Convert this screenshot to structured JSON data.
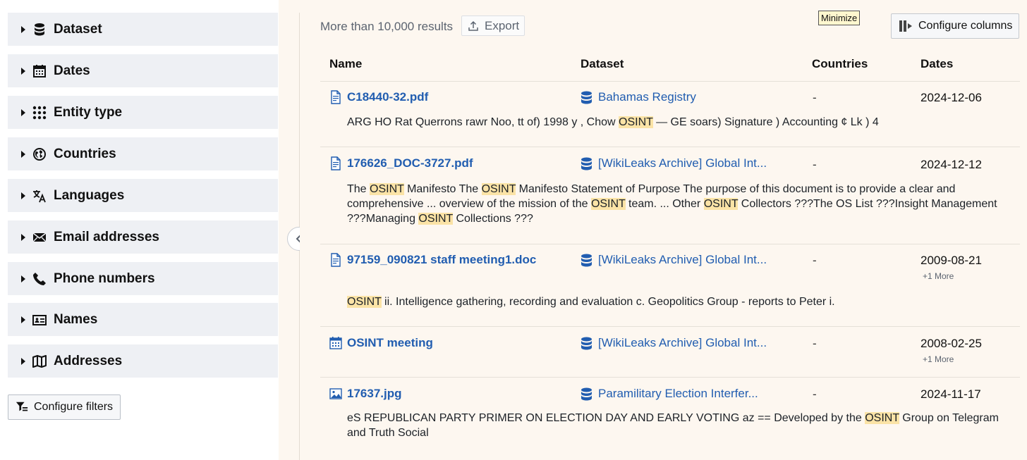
{
  "sidebar": {
    "facets": [
      {
        "label": "Dataset",
        "icon": "database-icon"
      },
      {
        "label": "Dates",
        "icon": "calendar-icon"
      },
      {
        "label": "Entity type",
        "icon": "grid-dots-icon"
      },
      {
        "label": "Countries",
        "icon": "globe-icon"
      },
      {
        "label": "Languages",
        "icon": "translate-icon"
      },
      {
        "label": "Email addresses",
        "icon": "envelope-icon"
      },
      {
        "label": "Phone numbers",
        "icon": "phone-icon"
      },
      {
        "label": "Names",
        "icon": "id-card-icon"
      },
      {
        "label": "Addresses",
        "icon": "map-icon"
      }
    ],
    "configure_filters_label": "Configure filters"
  },
  "toolbar": {
    "results_count": "More than 10,000 results",
    "export_label": "Export",
    "tooltip": "Minimize",
    "configure_columns_label": "Configure columns"
  },
  "table": {
    "headers": {
      "name": "Name",
      "dataset": "Dataset",
      "countries": "Countries",
      "dates": "Dates"
    },
    "highlight_term": "OSINT",
    "rows": [
      {
        "name": "C18440-32.pdf",
        "icon": "pdf-file-icon",
        "dataset": "Bahamas Registry",
        "countries": "-",
        "date": "2024-12-06",
        "more": "",
        "snippet": "ARG HO Rat Querrons rawr Noo, tt of) 1998 y , Chow OSINT — GE soars) Signature ) Accounting ¢ Lk ) 4"
      },
      {
        "name": "176626_DOC-3727.pdf",
        "icon": "pdf-file-icon",
        "dataset": "[WikiLeaks Archive] Global Int...",
        "countries": "-",
        "date": "2024-12-12",
        "more": "",
        "snippet": "The OSINT Manifesto The OSINT Manifesto Statement of Purpose The purpose of this document is to provide a clear and comprehensive ... overview of the mission of the OSINT team. ... Other OSINT Collectors ???The OS List ???Insight Management ???Managing OSINT Collections ???"
      },
      {
        "name": "97159_090821 staff meeting1.doc",
        "icon": "doc-file-icon",
        "dataset": "[WikiLeaks Archive] Global Int...",
        "countries": "-",
        "date": "2009-08-21",
        "more": "+1 More",
        "snippet": "OSINT ii. Intelligence gathering, recording and evaluation c. Geopolitics Group - reports to Peter i."
      },
      {
        "name": "OSINT meeting",
        "icon": "calendar-event-icon",
        "dataset": "[WikiLeaks Archive] Global Int...",
        "countries": "-",
        "date": "2008-02-25",
        "more": "+1 More",
        "snippet": ""
      },
      {
        "name": "17637.jpg",
        "icon": "image-file-icon",
        "dataset": "Paramilitary Election Interfer...",
        "countries": "-",
        "date": "2024-11-17",
        "more": "",
        "snippet": "eS REPUBLICAN PARTY PRIMER ON ELECTION DAY AND EARLY VOTING az == Developed by the OSINT Group on Telegram and Truth Social"
      }
    ]
  },
  "colors": {
    "accent_link": "#215db0",
    "highlight": "#fbe3a6",
    "panel_bg": "#fdf7f0",
    "facet_bg": "#eef0f4"
  }
}
